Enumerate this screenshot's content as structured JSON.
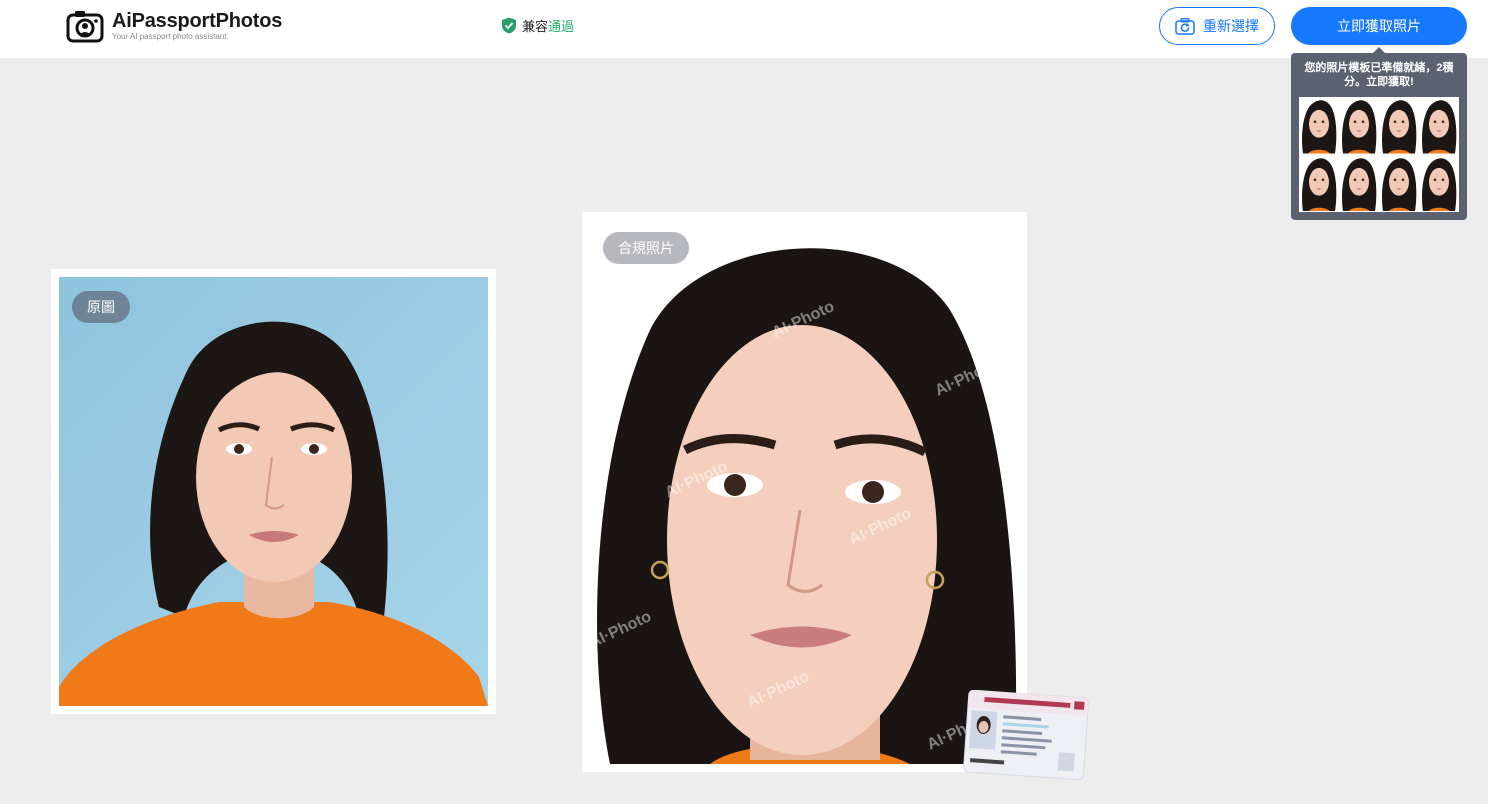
{
  "header": {
    "logo": {
      "name": "AiPassportPhotos",
      "tagline": "Your AI passport photo assistant."
    },
    "compat": {
      "label": "兼容",
      "status": "通過",
      "status_color": "#21b36a"
    },
    "reselect_label": "重新選擇",
    "get_photo_label": "立即獲取照片",
    "accent": "#1677ff"
  },
  "template_tip": {
    "message": "您的照片模板已準備就緒，2積分。立即獲取!",
    "thumbnail_count": 8
  },
  "photos": {
    "original_label": "原圖",
    "compliant_label": "合規照片",
    "watermark": "AI·Photo"
  }
}
